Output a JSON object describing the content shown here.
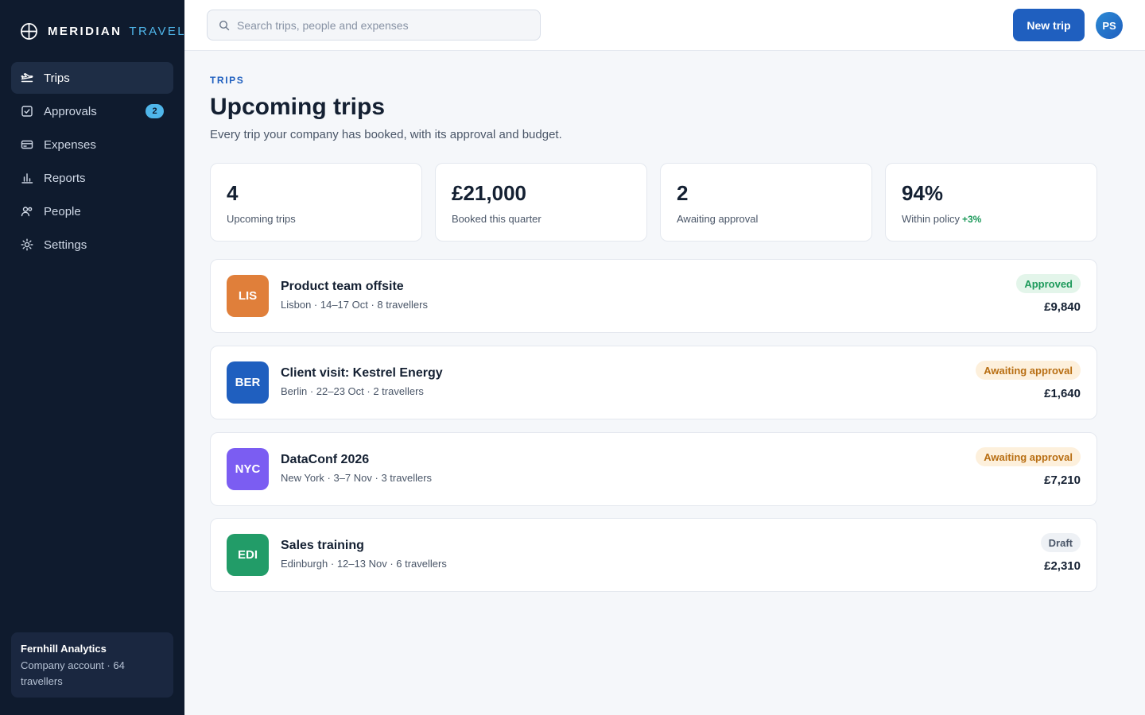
{
  "brand": {
    "name": "MERIDIAN",
    "sub": "TRAVEL"
  },
  "sidebar": {
    "items": [
      {
        "label": "Trips",
        "icon": "plane-icon",
        "active": true
      },
      {
        "label": "Approvals",
        "icon": "check-square-icon",
        "badge": "2"
      },
      {
        "label": "Expenses",
        "icon": "credit-card-icon"
      },
      {
        "label": "Reports",
        "icon": "bar-chart-icon"
      },
      {
        "label": "People",
        "icon": "users-icon"
      },
      {
        "label": "Settings",
        "icon": "gear-icon"
      }
    ],
    "account": {
      "name": "Fernhill Analytics",
      "meta": "Company account · 64 travellers"
    }
  },
  "topbar": {
    "search_placeholder": "Search trips, people and expenses",
    "new_trip_label": "New trip",
    "avatar_initials": "PS"
  },
  "page": {
    "eyebrow": "TRIPS",
    "title": "Upcoming trips",
    "subtitle": "Every trip your company has booked, with its approval and budget."
  },
  "stats": [
    {
      "value": "4",
      "label": "Upcoming trips"
    },
    {
      "value": "£21,000",
      "label": "Booked this quarter"
    },
    {
      "value": "2",
      "label": "Awaiting approval"
    },
    {
      "value": "94%",
      "label": "Within policy",
      "delta": "+3%"
    }
  ],
  "trips": [
    {
      "code": "LIS",
      "color": "#e07f3a",
      "name": "Product team offsite",
      "meta": "Lisbon · 14–17 Oct · 8 travellers",
      "status": "Approved",
      "status_fg": "#1d9a5b",
      "status_bg": "#e3f5ea",
      "cost": "£9,840"
    },
    {
      "code": "BER",
      "color": "#1f5fbf",
      "name": "Client visit: Kestrel Energy",
      "meta": "Berlin · 22–23 Oct · 2 travellers",
      "status": "Awaiting approval",
      "status_fg": "#b86e12",
      "status_bg": "#fdf0dc",
      "cost": "£1,640"
    },
    {
      "code": "NYC",
      "color": "#7b5df2",
      "name": "DataConf 2026",
      "meta": "New York · 3–7 Nov · 3 travellers",
      "status": "Awaiting approval",
      "status_fg": "#b86e12",
      "status_bg": "#fdf0dc",
      "cost": "£7,210"
    },
    {
      "code": "EDI",
      "color": "#229c68",
      "name": "Sales training",
      "meta": "Edinburgh · 12–13 Nov · 6 travellers",
      "status": "Draft",
      "status_fg": "#4a5668",
      "status_bg": "#eef1f5",
      "cost": "£2,310"
    }
  ]
}
